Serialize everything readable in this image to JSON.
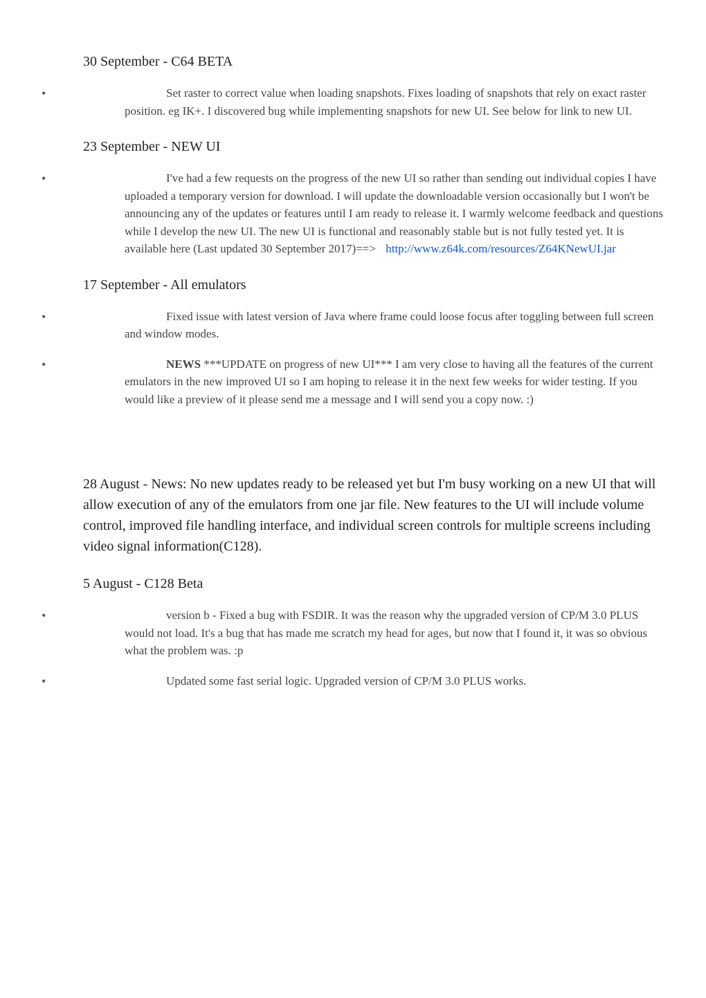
{
  "sections": [
    {
      "heading": "30 September - C64 BETA",
      "items": [
        {
          "text": "Set raster to correct value when loading snapshots.  Fixes loading of snapshots that rely on exact raster position. eg IK+. I discovered bug while implementing snapshots for new UI. See below for link to new UI."
        }
      ]
    },
    {
      "heading": "23 September - NEW UI",
      "items": [
        {
          "text_before_link": "I've had a few requests on the progress of the new UI so rather than sending out individual copies I have uploaded a temporary version for download.  I will update the downloadable version occasionally but I won't be announcing any of the updates or features until I am ready to release it. I warmly welcome feedback and questions while I develop the new UI.  The new UI is functional and reasonably stable but is not fully tested yet. It is available here (Last updated 30 September 2017)==> ",
          "link_text": "http://www.z64k.com/resources/Z64KNewUI.jar",
          "link_href": "http://www.z64k.com/resources/Z64KNewUI.jar"
        }
      ]
    },
    {
      "heading": "17 September - All emulators",
      "items": [
        {
          "text": "Fixed issue with latest version of Java where frame could loose focus after toggling between full screen and window modes."
        },
        {
          "news_prefix": "NEWS",
          "text": " ***UPDATE on progress of new UI***  I am very close to having all the features of the current emulators in the new improved UI so I am hoping to release it in the next few weeks for wider testing.  If you would like a preview of it please send me a message and I will send you a copy now. :)"
        }
      ]
    },
    {
      "heading": "28 August - News: No new updates ready to be released yet but I'm busy working on a new UI that will allow execution of any of the emulators from one jar file.  New features to the UI will include volume control, improved file handling interface, and individual screen controls for multiple screens including video signal information(C128).",
      "items": []
    },
    {
      "heading": "5 August - C128 Beta",
      "items": [
        {
          "text": "version b - Fixed a bug with FSDIR. It was the reason why the upgraded version of CP/M 3.0 PLUS would not load. It's a bug that has made me scratch my head for ages, but now that I found it, it was so obvious what the problem was. :p"
        },
        {
          "text": "Updated some fast serial logic.  Upgraded version of CP/M 3.0 PLUS works."
        }
      ]
    }
  ]
}
